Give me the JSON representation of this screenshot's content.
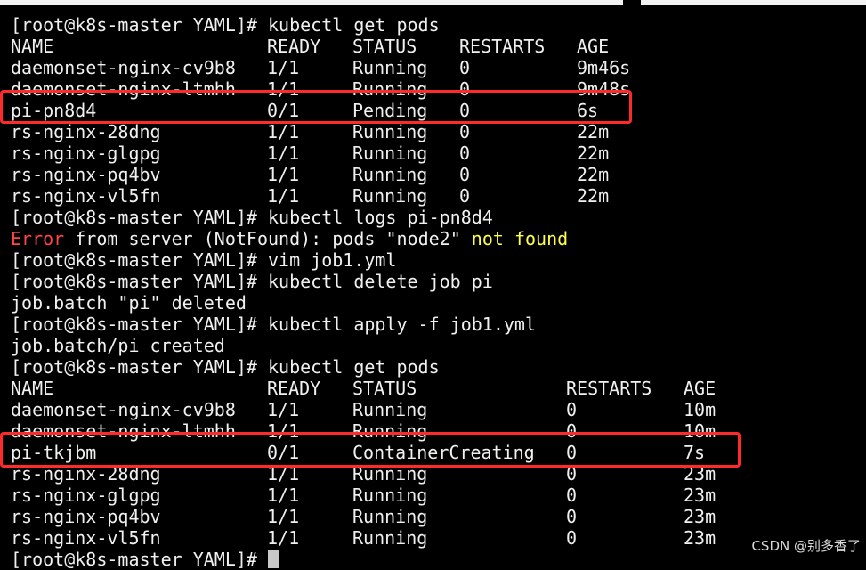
{
  "prompt": "[root@k8s-master YAML]# ",
  "block1": {
    "command": "kubectl get pods",
    "headers": [
      "NAME",
      "READY",
      "STATUS",
      "RESTARTS",
      "AGE"
    ],
    "rows": [
      [
        "daemonset-nginx-cv9b8",
        "1/1",
        "Running",
        "0",
        "9m46s"
      ],
      [
        "daemonset-nginx-ltmhh",
        "1/1",
        "Running",
        "0",
        "9m48s"
      ],
      [
        "pi-pn8d4",
        "0/1",
        "Pending",
        "0",
        "6s"
      ],
      [
        "rs-nginx-28dng",
        "1/1",
        "Running",
        "0",
        "22m"
      ],
      [
        "rs-nginx-glgpg",
        "1/1",
        "Running",
        "0",
        "22m"
      ],
      [
        "rs-nginx-pq4bv",
        "1/1",
        "Running",
        "0",
        "22m"
      ],
      [
        "rs-nginx-vl5fn",
        "1/1",
        "Running",
        "0",
        "22m"
      ]
    ]
  },
  "cmd_logs": "kubectl logs pi-pn8d4",
  "error": {
    "word": "Error",
    "middle": " from server (NotFound): pods \"node2\" ",
    "tail": "not found"
  },
  "cmd_vim": "vim job1.yml",
  "cmd_delete": "kubectl delete job pi",
  "out_delete": "job.batch \"pi\" deleted",
  "cmd_apply": "kubectl apply -f job1.yml",
  "out_apply": "job.batch/pi created",
  "block2": {
    "command": "kubectl get pods",
    "headers": [
      "NAME",
      "READY",
      "STATUS",
      "RESTARTS",
      "AGE"
    ],
    "rows": [
      [
        "daemonset-nginx-cv9b8",
        "1/1",
        "Running",
        "0",
        "10m"
      ],
      [
        "daemonset-nginx-ltmhh",
        "1/1",
        "Running",
        "0",
        "10m"
      ],
      [
        "pi-tkjbm",
        "0/1",
        "ContainerCreating",
        "0",
        "7s"
      ],
      [
        "rs-nginx-28dng",
        "1/1",
        "Running",
        "0",
        "23m"
      ],
      [
        "rs-nginx-glgpg",
        "1/1",
        "Running",
        "0",
        "23m"
      ],
      [
        "rs-nginx-pq4bv",
        "1/1",
        "Running",
        "0",
        "23m"
      ],
      [
        "rs-nginx-vl5fn",
        "1/1",
        "Running",
        "0",
        "23m"
      ]
    ]
  },
  "watermark": "CSDN @别多香了",
  "colors": {
    "background": "#000000",
    "text": "#f0f0f0",
    "error_red": "#ff4545",
    "error_yellow": "#ffff44",
    "highlight_box": "#ff2b2b"
  }
}
